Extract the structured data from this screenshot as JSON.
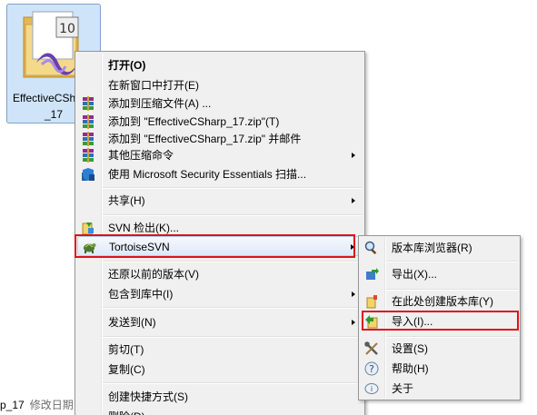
{
  "file": {
    "name_line1": "EffectiveCSh",
    "name_line2": "_17",
    "badge": "10"
  },
  "status": {
    "name": "p_17",
    "label": "修改日期"
  },
  "main_menu": {
    "items": [
      {
        "id": "open",
        "label": "打开(O)",
        "icon": "none"
      },
      {
        "id": "open-new-window",
        "label": "在新窗口中打开(E)",
        "icon": "none"
      },
      {
        "id": "add-to-archive",
        "label": "添加到压缩文件(A) ...",
        "icon": "winrar-icon"
      },
      {
        "id": "add-to-zip",
        "label": "添加到 \"EffectiveCSharp_17.zip\"(T)",
        "icon": "winrar-icon"
      },
      {
        "id": "add-to-zip-mail",
        "label": "添加到 \"EffectiveCSharp_17.zip\" 并邮件",
        "icon": "winrar-icon"
      },
      {
        "id": "other-compress",
        "label": "其他压缩命令",
        "icon": "winrar-icon",
        "submenu": true
      },
      {
        "id": "mse-scan",
        "label": "使用 Microsoft Security Essentials 扫描...",
        "icon": "mse-icon"
      },
      {
        "id": "share",
        "label": "共享(H)",
        "icon": "none",
        "submenu": true
      },
      {
        "id": "svn-checkout",
        "label": "SVN 检出(K)...",
        "icon": "svn-checkout-icon"
      },
      {
        "id": "tortoisesvn",
        "label": "TortoiseSVN",
        "icon": "tortoise-icon",
        "submenu": true
      },
      {
        "id": "restore-versions",
        "label": "还原以前的版本(V)",
        "icon": "none"
      },
      {
        "id": "include-library",
        "label": "包含到库中(I)",
        "icon": "none",
        "submenu": true
      },
      {
        "id": "send-to",
        "label": "发送到(N)",
        "icon": "none",
        "submenu": true
      },
      {
        "id": "cut",
        "label": "剪切(T)",
        "icon": "none"
      },
      {
        "id": "copy",
        "label": "复制(C)",
        "icon": "none"
      },
      {
        "id": "create-shortcut",
        "label": "创建快捷方式(S)",
        "icon": "none"
      },
      {
        "id": "delete",
        "label": "删除(D)",
        "icon": "none"
      }
    ]
  },
  "sub_menu": {
    "items": [
      {
        "id": "repo-browser",
        "label": "版本库浏览器(R)",
        "icon": "repo-browser-icon"
      },
      {
        "id": "export",
        "label": "导出(X)...",
        "icon": "export-icon"
      },
      {
        "id": "create-repo",
        "label": "在此处创建版本库(Y)",
        "icon": "create-repo-icon"
      },
      {
        "id": "import",
        "label": "导入(I)...",
        "icon": "import-icon"
      },
      {
        "id": "settings",
        "label": "设置(S)",
        "icon": "settings-icon"
      },
      {
        "id": "help",
        "label": "帮助(H)",
        "icon": "help-icon"
      },
      {
        "id": "about",
        "label": "关于",
        "icon": "about-icon"
      }
    ]
  },
  "colors": {
    "highlight_border": "#e0101a",
    "menu_bg": "#f0f0f0",
    "selection": "#cfe4f8"
  }
}
